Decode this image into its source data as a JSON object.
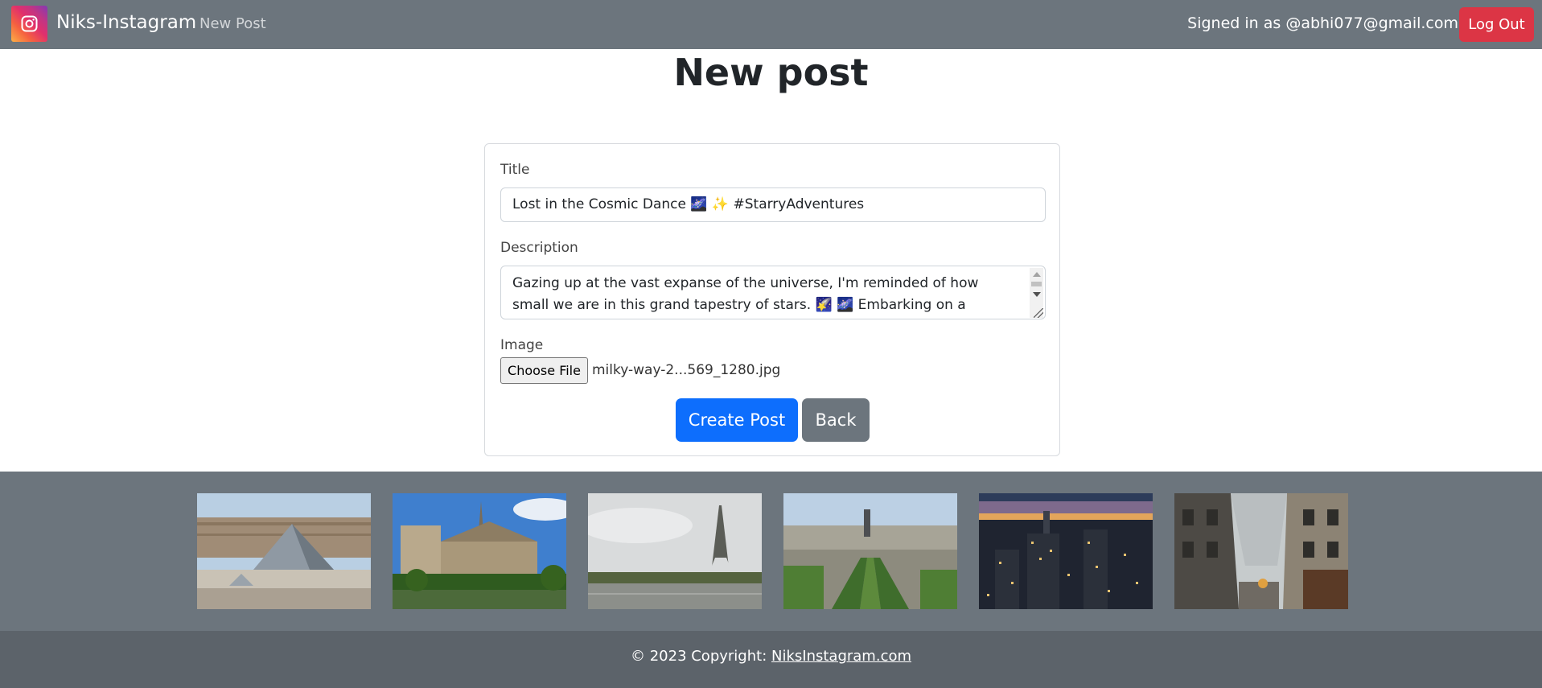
{
  "navbar": {
    "brand": "Niks-Instagram",
    "logo_icon": "instagram-icon",
    "new_post_link": "New Post",
    "signed_in_text": "Signed in as @abhi077@gmail.com",
    "logout_label": "Log Out",
    "logout_color": "#dc3545",
    "background_color": "#6c757d"
  },
  "page": {
    "title": "New post"
  },
  "form": {
    "title_label": "Title",
    "title_value": "Lost in the Cosmic Dance 🌌 ✨ #StarryAdventures",
    "description_label": "Description",
    "description_value": "Gazing up at the vast expanse of the universe, I'm reminded of how small we are in this grand tapestry of stars. 🌠 🌌 Embarking on a celestial journey that",
    "image_label": "Image",
    "choose_file_label": "Choose File",
    "file_name": "milky-way-2...569_1280.jpg",
    "create_label": "Create Post",
    "back_label": "Back",
    "create_color": "#0d6efd",
    "back_color": "#6c757d"
  },
  "gallery": {
    "images": [
      {
        "name": "louvre-pyramid"
      },
      {
        "name": "notre-dame"
      },
      {
        "name": "eiffel-tower"
      },
      {
        "name": "paris-aerial"
      },
      {
        "name": "city-skyline-sunset"
      },
      {
        "name": "paris-street"
      }
    ]
  },
  "footer": {
    "copyright": "© 2023 Copyright:",
    "link_text": "NiksInstagram.com"
  }
}
